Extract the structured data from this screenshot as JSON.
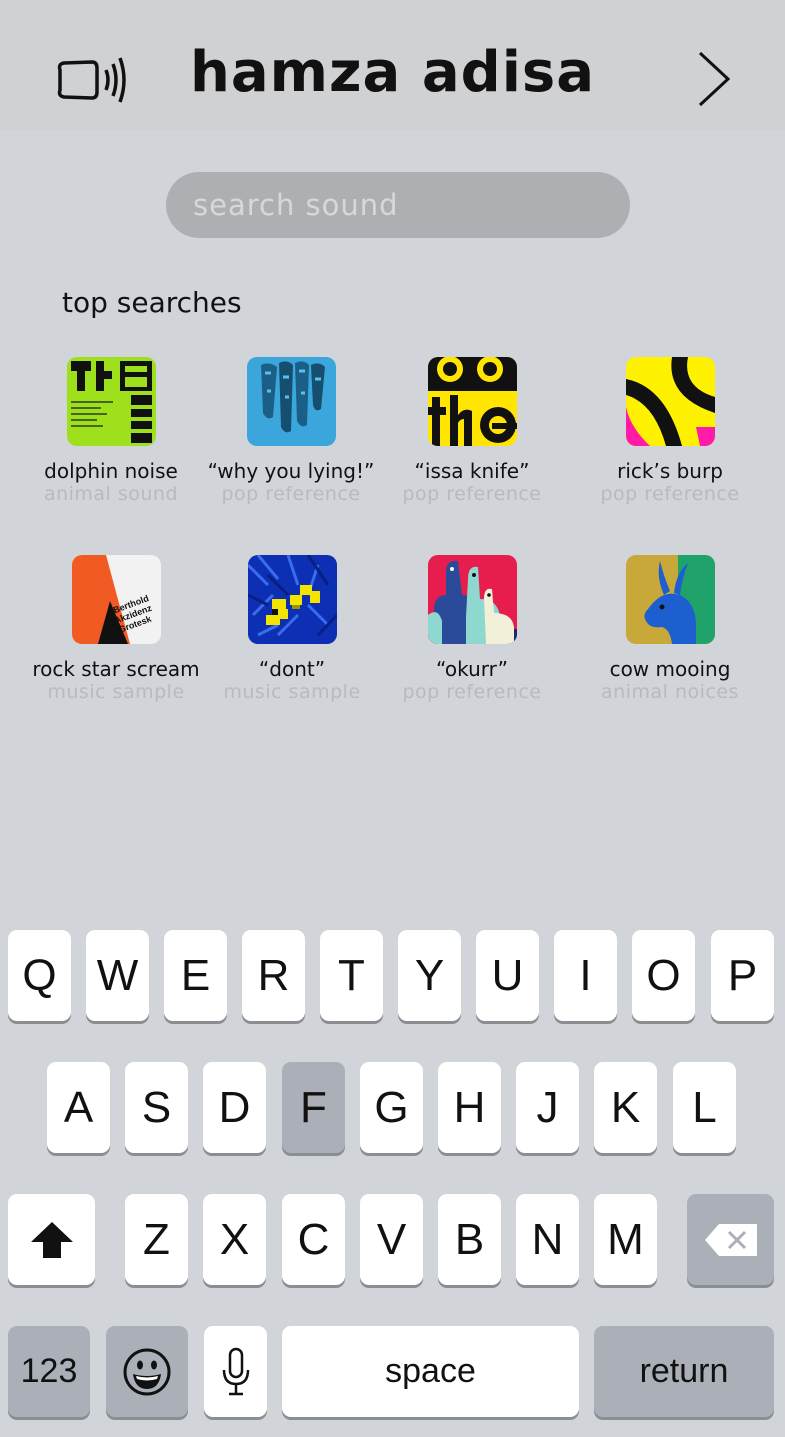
{
  "header": {
    "title": "hamza adisa"
  },
  "search": {
    "placeholder": "search sound"
  },
  "section": {
    "title": "top searches"
  },
  "tiles": [
    {
      "name": "dolphin noise",
      "category": "animal sound",
      "icon": "album-art-green-poster"
    },
    {
      "name": "“why you lying!”",
      "category": "pop reference",
      "icon": "album-art-blue-sculpture"
    },
    {
      "name": "“issa knife”",
      "category": "pop reference",
      "icon": "album-art-yellow-type"
    },
    {
      "name": "rick’s burp",
      "category": "pop reference",
      "icon": "album-art-yellow-abstract"
    },
    {
      "name": "rock star scream",
      "category": "music sample",
      "icon": "album-art-orange-grotesk"
    },
    {
      "name": "“dont”",
      "category": "music sample",
      "icon": "album-art-blue-pixel"
    },
    {
      "name": "“okurr”",
      "category": "pop reference",
      "icon": "album-art-pink-llamas"
    },
    {
      "name": "cow mooing",
      "category": "animal noices",
      "icon": "album-art-antelope"
    }
  ],
  "art": {
    "grotesk_lines": [
      "Berthold",
      "Akzidenz",
      "Grotesk"
    ],
    "grotesk_lines_text": "Berthold Akzidenz Grotesk"
  },
  "keyboard": {
    "row1": [
      "Q",
      "W",
      "E",
      "R",
      "T",
      "Y",
      "U",
      "I",
      "O",
      "P"
    ],
    "row2": [
      "A",
      "S",
      "D",
      "F",
      "G",
      "H",
      "J",
      "K",
      "L"
    ],
    "row3": [
      "Z",
      "X",
      "C",
      "V",
      "B",
      "N",
      "M"
    ],
    "highlighted_key": "F",
    "numbers_label": "123",
    "space_label": "space",
    "return_label": "return"
  },
  "colors": {
    "header_bg": "#d0d1d3",
    "page_bg": "#d1d4d9",
    "search_bg": "#adafb3",
    "key_bg": "#ffffff",
    "key_dark_bg": "#abb0b8",
    "category_text": "#b8babd"
  }
}
